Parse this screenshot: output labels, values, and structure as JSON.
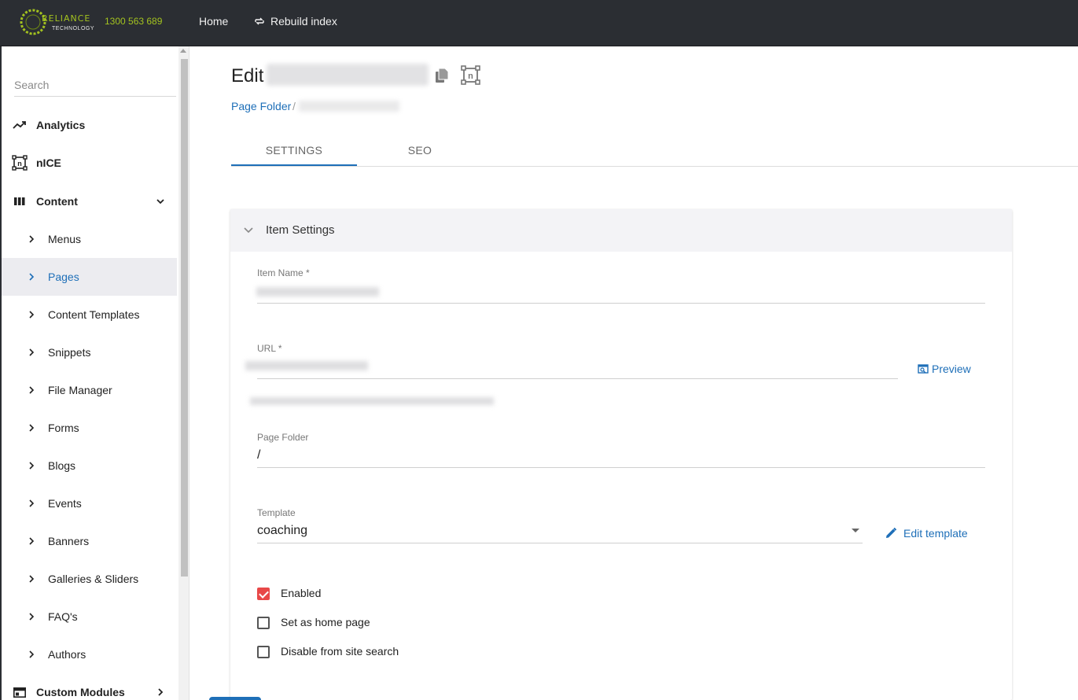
{
  "colors": {
    "topbar": "#2b2e33",
    "accent": "#1e6fb8",
    "brand_green": "#a3c21f",
    "checkbox_on": "#e84848"
  },
  "topbar": {
    "logo_text": "RELIANCE",
    "logo_sub": "TECHNOLOGY",
    "phone": "1300 563 689",
    "home_label": "Home",
    "rebuild_label": "Rebuild index",
    "rebuild_icon": "refresh-icon"
  },
  "sidebar": {
    "search_placeholder": "Search",
    "top_items": [
      {
        "label": "Analytics",
        "icon": "trending-up-icon"
      },
      {
        "label": "nICE",
        "icon": "nice-icon"
      },
      {
        "label": "Content",
        "icon": "columns-icon"
      }
    ],
    "content_items": [
      {
        "label": "Menus"
      },
      {
        "label": "Pages",
        "active": true
      },
      {
        "label": "Content Templates"
      },
      {
        "label": "Snippets"
      },
      {
        "label": "File Manager"
      },
      {
        "label": "Forms"
      },
      {
        "label": "Blogs"
      },
      {
        "label": "Events"
      },
      {
        "label": "Banners"
      },
      {
        "label": "Galleries & Sliders"
      },
      {
        "label": "FAQ's"
      },
      {
        "label": "Authors"
      }
    ],
    "bottom_item": {
      "label": "Custom Modules",
      "icon": "module-icon"
    }
  },
  "main": {
    "title_prefix": "Edit",
    "breadcrumb_link": "Page Folder",
    "breadcrumb_sep": "/",
    "tabs": [
      {
        "label": "SETTINGS",
        "active": true
      },
      {
        "label": "SEO"
      }
    ]
  },
  "item_settings": {
    "header": "Item Settings",
    "item_name_label": "Item Name *",
    "url_label": "URL *",
    "preview_label": "Preview",
    "page_folder_label": "Page Folder",
    "page_folder_value": "/",
    "template_label": "Template",
    "template_value": "coaching",
    "edit_template_label": "Edit template",
    "checkboxes": [
      {
        "label": "Enabled",
        "checked": true
      },
      {
        "label": "Set as home page",
        "checked": false
      },
      {
        "label": "Disable from site search",
        "checked": false
      }
    ]
  }
}
